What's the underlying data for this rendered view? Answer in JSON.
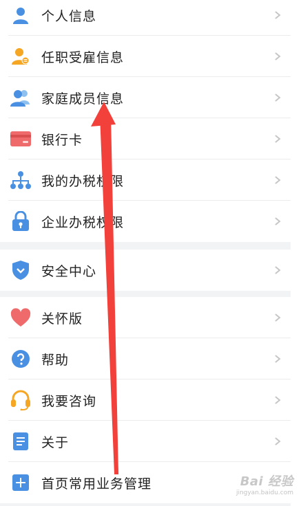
{
  "sections": [
    {
      "items": [
        {
          "label": "个人信息",
          "icon": "person-icon"
        },
        {
          "label": "任职受雇信息",
          "icon": "employee-badge-icon"
        },
        {
          "label": "家庭成员信息",
          "icon": "family-members-icon"
        },
        {
          "label": "银行卡",
          "icon": "bank-card-icon"
        },
        {
          "label": "我的办税权限",
          "icon": "org-tree-icon"
        },
        {
          "label": "企业办税权限",
          "icon": "lock-icon"
        }
      ]
    },
    {
      "items": [
        {
          "label": "安全中心",
          "icon": "shield-icon"
        }
      ]
    },
    {
      "items": [
        {
          "label": "关怀版",
          "icon": "heart-icon"
        },
        {
          "label": "帮助",
          "icon": "question-icon"
        },
        {
          "label": "我要咨询",
          "icon": "headset-icon"
        },
        {
          "label": "关于",
          "icon": "document-icon"
        },
        {
          "label": "首页常用业务管理",
          "icon": "plus-square-icon"
        }
      ]
    }
  ],
  "colors": {
    "icon_blue": "#4a90e2",
    "icon_orange": "#f5a623",
    "icon_red": "#ef6b6b",
    "annotation_arrow": "#f2403a"
  },
  "watermark": {
    "logo": "Bai 经验",
    "url": "jingyan.baidu.com"
  }
}
